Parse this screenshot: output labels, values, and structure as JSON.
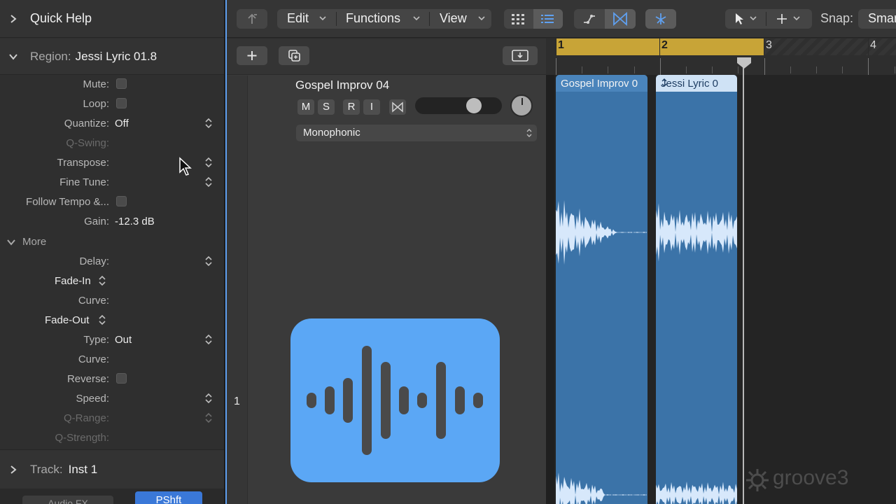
{
  "inspector": {
    "quick_help": "Quick Help",
    "region_label": "Region:",
    "region_name": "Jessi Lyric 01.8",
    "params": [
      {
        "label": "Mute:",
        "value": "",
        "kind": "checkbox"
      },
      {
        "label": "Loop:",
        "value": "",
        "kind": "checkbox"
      },
      {
        "label": "Quantize:",
        "value": "Off",
        "kind": "stepper"
      },
      {
        "label": "Q-Swing:",
        "value": "",
        "kind": "dim"
      },
      {
        "label": "Transpose:",
        "value": "",
        "kind": "stepper"
      },
      {
        "label": "Fine Tune:",
        "value": "",
        "kind": "stepper"
      },
      {
        "label": "Follow Tempo &...",
        "value": "",
        "kind": "checkbox"
      },
      {
        "label": "Gain:",
        "value": "-12.3 dB",
        "kind": "value"
      }
    ],
    "more_label": "More",
    "more_params": [
      {
        "label": "Delay:",
        "value": "",
        "kind": "stepper"
      },
      {
        "label": "Fade-In",
        "value": "",
        "kind": "fade"
      },
      {
        "label": "Curve:",
        "value": "",
        "kind": "plain"
      },
      {
        "label": "Fade-Out",
        "value": "",
        "kind": "fade"
      },
      {
        "label": "Type:",
        "value": "Out",
        "kind": "stepper"
      },
      {
        "label": "Curve:",
        "value": "",
        "kind": "plain"
      },
      {
        "label": "Reverse:",
        "value": "",
        "kind": "checkbox"
      },
      {
        "label": "Speed:",
        "value": "",
        "kind": "stepper"
      },
      {
        "label": "Q-Range:",
        "value": "",
        "kind": "dimstepper"
      },
      {
        "label": "Q-Strength:",
        "value": "",
        "kind": "dim"
      }
    ],
    "track_label": "Track:",
    "track_name": "Inst 1",
    "audio_fx": "Audio FX",
    "pshft": "PShft"
  },
  "toolbar": {
    "edit": "Edit",
    "functions": "Functions",
    "view": "View",
    "snap_label": "Snap:",
    "snap_value": "Smart"
  },
  "track": {
    "number": "1",
    "name": "Gospel Improv 04",
    "buttons": [
      "M",
      "S",
      "R",
      "I"
    ],
    "mode": "Monophonic",
    "volume_level": 0.72
  },
  "ruler": {
    "bars": [
      "1",
      "2",
      "3",
      "4"
    ]
  },
  "regions": [
    {
      "name": "Gospel Improv 0",
      "selected": false
    },
    {
      "name": "Jessi Lyric 0",
      "selected": true
    }
  ],
  "watermark": "groove3",
  "colors": {
    "accent": "#5fa0f0",
    "region": "#3b73a8",
    "cycle": "#c8a437",
    "track_icon": "#5ba7f5"
  }
}
